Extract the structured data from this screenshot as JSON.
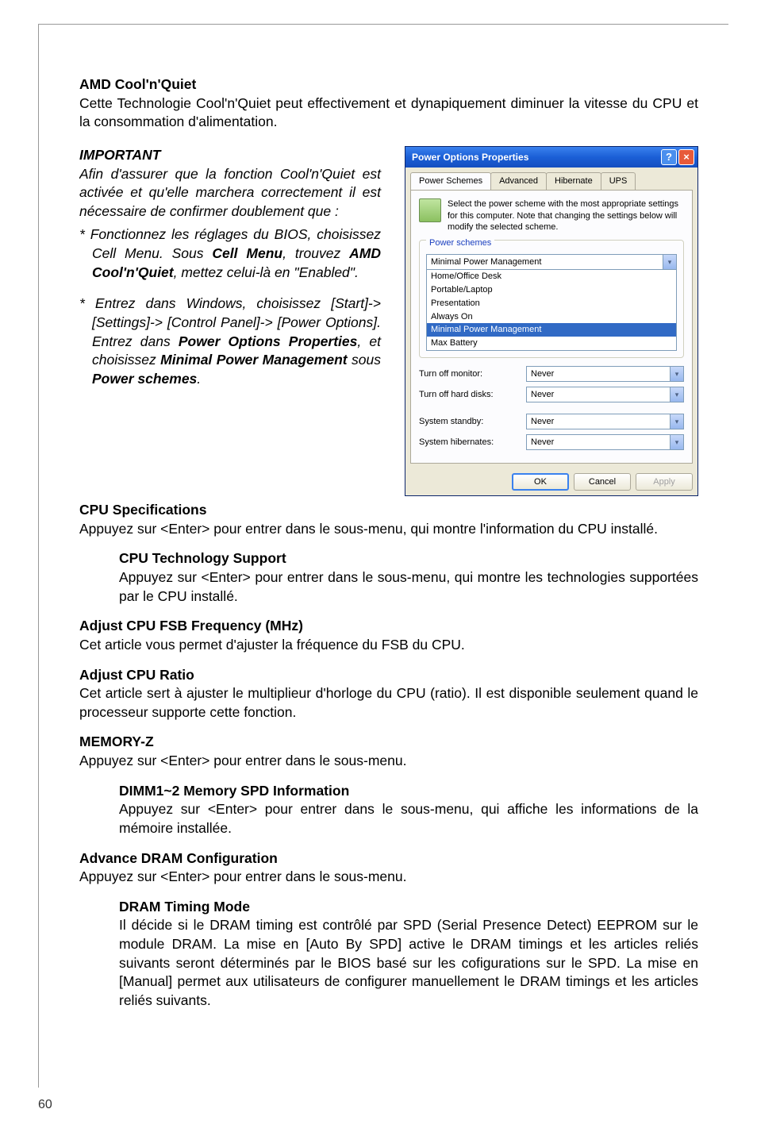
{
  "page_number": "60",
  "sections": {
    "amd_cnq": {
      "heading": "AMD Cool'n'Quiet",
      "body": "Cette Technologie Cool'n'Quiet peut effectivement et dynapiquement diminuer la vitesse du CPU et la consommation d'alimentation."
    },
    "important": {
      "heading": "IMPORTANT",
      "intro": "Afin d'assurer que la fonction Cool'n'Quiet est activée et qu'elle marchera correctement il est nécessaire de confirmer doublement que :",
      "item1_a": "Fonctionnez les réglages du BIOS, choisissez Cell Menu. Sous ",
      "item1_b": "Cell Menu",
      "item1_c": ", trouvez ",
      "item1_d": "AMD Cool'n'Quiet",
      "item1_e": ", mettez celui-là en \"Enabled\".",
      "item2_a": "Entrez dans Windows, choisissez [Start]-> [Settings]-> [Control Panel]-> [Power Options]. Entrez dans ",
      "item2_b": "Power Options Properties",
      "item2_c": ", et choisissez ",
      "item2_d": "Minimal Power Management",
      "item2_e": " sous ",
      "item2_f": "Power schemes",
      "item2_g": "."
    },
    "cpu_spec": {
      "heading": "CPU Specifications",
      "body": "Appuyez sur <Enter> pour entrer dans le sous-menu, qui montre l'information du CPU installé."
    },
    "cpu_tech": {
      "heading": "CPU Technology Support",
      "body": "Appuyez sur <Enter> pour entrer dans le sous-menu, qui montre les technologies supportées par le CPU installé."
    },
    "fsb": {
      "heading": "Adjust CPU FSB Frequency (MHz)",
      "body": "Cet article vous permet d'ajuster la fréquence du FSB du CPU."
    },
    "ratio": {
      "heading": "Adjust CPU Ratio",
      "body": "Cet article sert à ajuster le multiplieur d'horloge du CPU (ratio). Il est disponible seulement quand le processeur supporte cette fonction."
    },
    "memz": {
      "heading": "MEMORY-Z",
      "body": "Appuyez sur <Enter> pour entrer dans le sous-menu."
    },
    "dimm": {
      "heading": "DIMM1~2 Memory SPD Information",
      "body": "Appuyez sur <Enter> pour entrer dans le sous-menu, qui affiche les informations de la mémoire installée."
    },
    "dram_cfg": {
      "heading": "Advance DRAM Configuration",
      "body": "Appuyez sur <Enter> pour entrer dans le sous-menu."
    },
    "dram_timing": {
      "heading": "DRAM Timing Mode",
      "body": "Il décide si le DRAM timing est contrôlé par SPD (Serial Presence Detect) EEPROM sur le module DRAM. La mise en [Auto By SPD] active le DRAM timings et les articles reliés suivants seront déterminés par le BIOS basé sur les cofigurations sur le SPD. La mise en [Manual] permet aux utilisateurs de configurer manuellement le DRAM timings et les articles reliés suivants."
    }
  },
  "dialog": {
    "title": "Power Options Properties",
    "help_btn": "?",
    "close_btn": "×",
    "tabs": [
      "Power Schemes",
      "Advanced",
      "Hibernate",
      "UPS"
    ],
    "intro": "Select the power scheme with the most appropriate settings for this computer. Note that changing the settings below will modify the selected scheme.",
    "fieldset1_legend": "Power schemes",
    "scheme_value": "Minimal Power Management",
    "scheme_options": [
      "Home/Office Desk",
      "Portable/Laptop",
      "Presentation",
      "Always On",
      "Minimal Power Management",
      "Max Battery"
    ],
    "settings": {
      "monitor_label": "Turn off monitor:",
      "monitor_value": "Never",
      "disks_label": "Turn off hard disks:",
      "disks_value": "Never",
      "standby_label": "System standby:",
      "standby_value": "Never",
      "hibernate_label": "System hibernates:",
      "hibernate_value": "Never"
    },
    "buttons": {
      "ok": "OK",
      "cancel": "Cancel",
      "apply": "Apply"
    }
  }
}
